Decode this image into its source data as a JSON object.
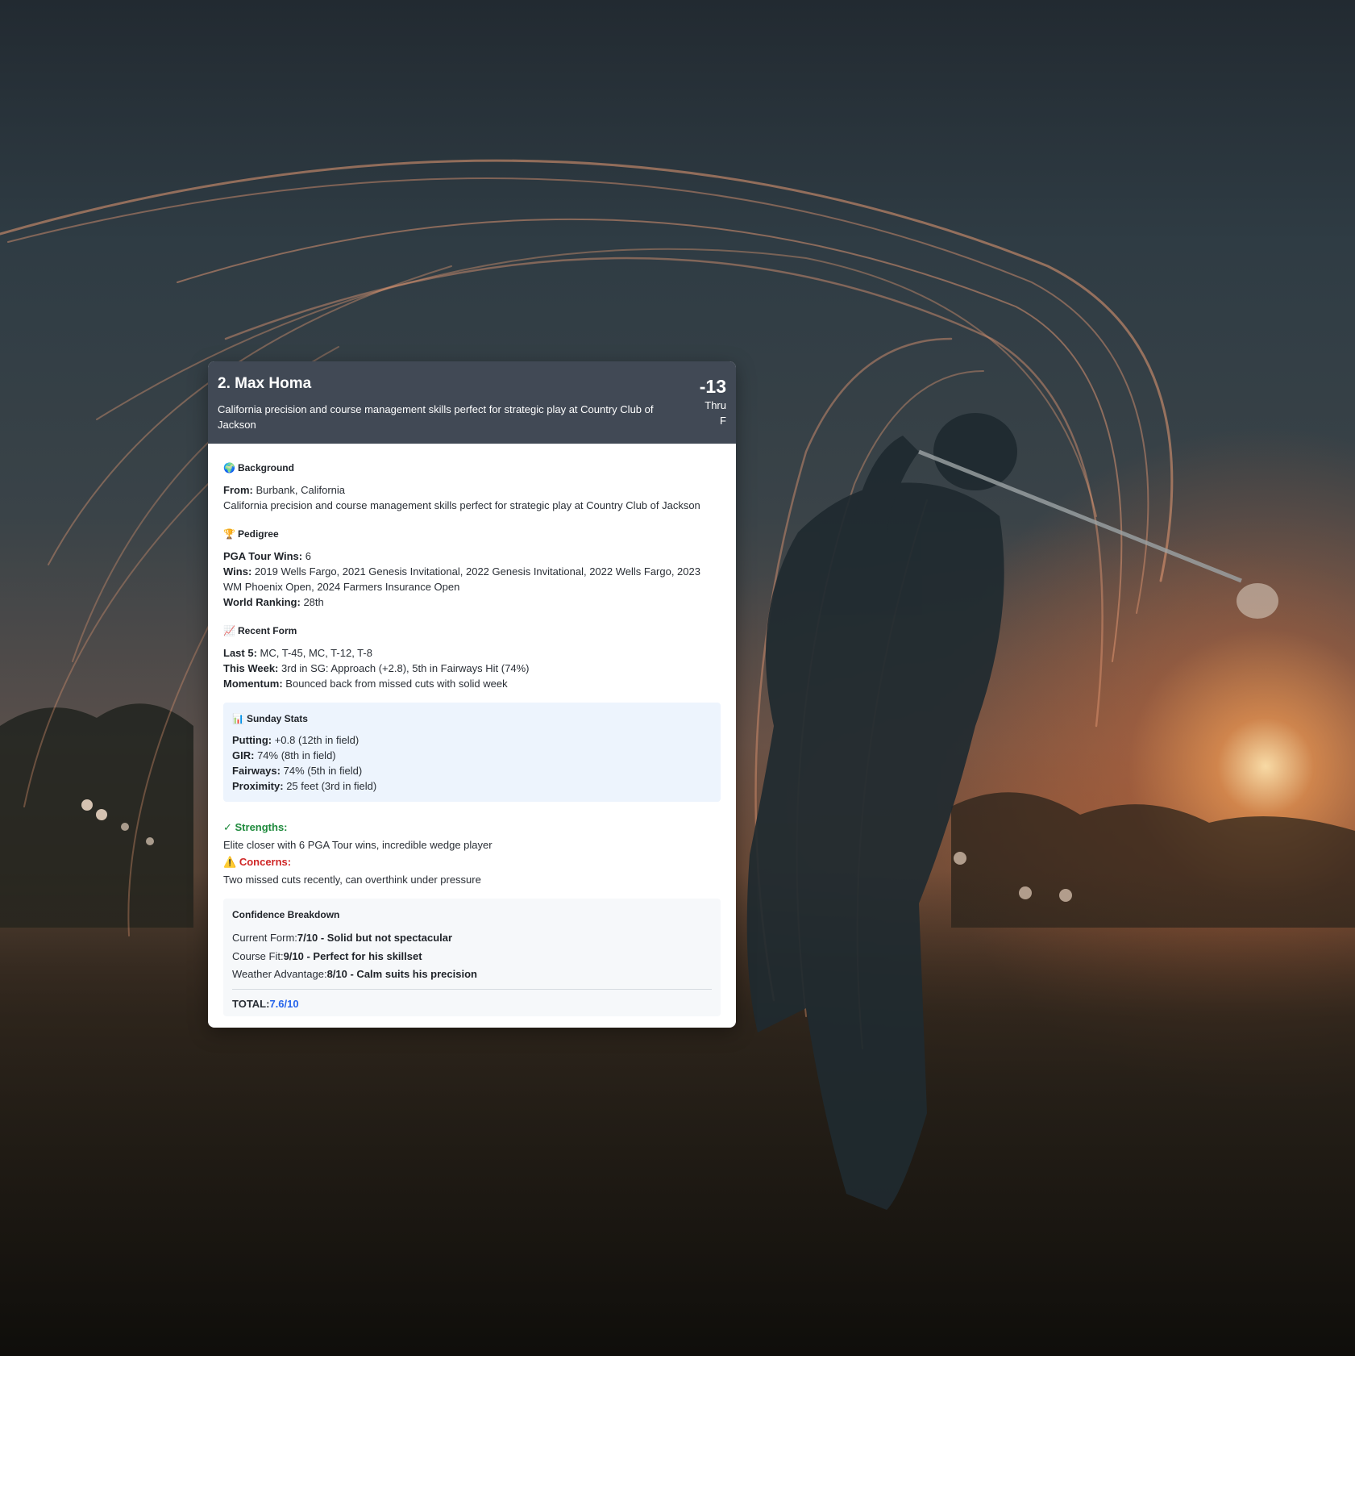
{
  "colors": {
    "header_bg": "#414955",
    "strength": "#1e8a3c",
    "concern": "#cf2626",
    "total_value": "#2563eb",
    "stats_bg": "#edf4fd"
  },
  "header": {
    "name": "2. Max Homa",
    "tagline": "California precision and course management skills perfect for strategic play at Country Club of Jackson",
    "score": "-13",
    "thru_label": "Thru",
    "thru_value": "F"
  },
  "background": {
    "icon": "globe-icon",
    "title": "Background",
    "from_label": "From:",
    "from_value": "Burbank, California",
    "description": "California precision and course management skills perfect for strategic play at Country Club of Jackson"
  },
  "pedigree": {
    "icon": "trophy-icon",
    "title": "Pedigree",
    "wins_count_label": "PGA Tour Wins:",
    "wins_count_value": "6",
    "wins_label": "Wins:",
    "wins_value": "2019 Wells Fargo, 2021 Genesis Invitational, 2022 Genesis Invitational, 2022 Wells Fargo, 2023 WM Phoenix Open, 2024 Farmers Insurance Open",
    "ranking_label": "World Ranking:",
    "ranking_value": "28th"
  },
  "recent_form": {
    "icon": "chart-increasing-icon",
    "title": "Recent Form",
    "last5_label": "Last 5:",
    "last5_value": "MC, T-45, MC, T-12, T-8",
    "this_week_label": "This Week:",
    "this_week_value": "3rd in SG: Approach (+2.8), 5th in Fairways Hit (74%)",
    "momentum_label": "Momentum:",
    "momentum_value": "Bounced back from missed cuts with solid week"
  },
  "sunday_stats": {
    "icon": "bar-chart-icon",
    "title": "Sunday Stats",
    "rows": [
      {
        "label": "Putting:",
        "value": "+0.8 (12th in field)"
      },
      {
        "label": "GIR:",
        "value": "74% (8th in field)"
      },
      {
        "label": "Fairways:",
        "value": "74% (5th in field)"
      },
      {
        "label": "Proximity:",
        "value": "25 feet (3rd in field)"
      }
    ]
  },
  "strengths": {
    "title": "✓ Strengths:",
    "text": "Elite closer with 6 PGA Tour wins, incredible wedge player"
  },
  "concerns": {
    "icon": "warning-icon",
    "title": "Concerns:",
    "text": "Two missed cuts recently, can overthink under pressure"
  },
  "confidence": {
    "title": "Confidence Breakdown",
    "rows": [
      {
        "label": "Current Form:",
        "value": "7/10 - Solid but not spectacular"
      },
      {
        "label": "Course Fit:",
        "value": "9/10 - Perfect for his skillset"
      },
      {
        "label": "Weather Advantage:",
        "value": "8/10 - Calm suits his precision"
      }
    ],
    "total_label": "TOTAL:",
    "total_value": "7.6/10"
  }
}
